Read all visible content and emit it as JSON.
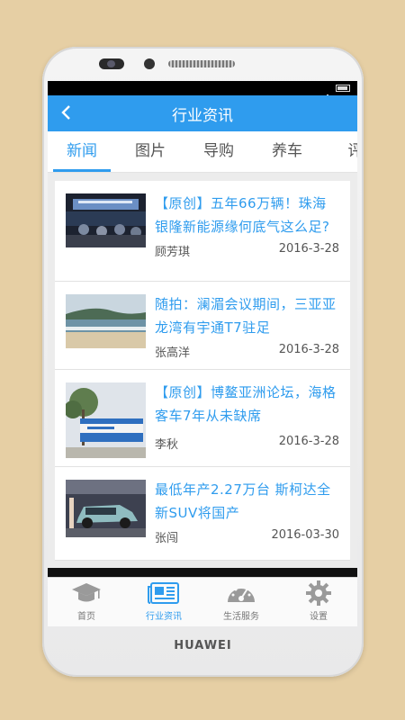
{
  "device": {
    "brand": "HUAWEI"
  },
  "appbar": {
    "title": "行业资讯",
    "back_icon": "chevron-left-icon"
  },
  "tabs": [
    {
      "label": "新闻",
      "active": true
    },
    {
      "label": "图片",
      "active": false
    },
    {
      "label": "导购",
      "active": false
    },
    {
      "label": "养车",
      "active": false
    },
    {
      "label": "评",
      "active": false
    }
  ],
  "articles": [
    {
      "title": "【原创】五年66万辆！珠海银隆新能源缘何底气这么足?",
      "author": "顾芳琪",
      "date": "2016-3-28",
      "thumb": "conference-stage"
    },
    {
      "title": "随拍：澜湄会议期间，三亚亚龙湾有宇通T7驻足",
      "author": "张高洋",
      "date": "2016-3-28",
      "thumb": "beach"
    },
    {
      "title": "【原创】博鳌亚洲论坛，海格客车7年从未缺席",
      "author": "李秋",
      "date": "2016-3-28",
      "thumb": "road-sign"
    },
    {
      "title": "最低年产2.27万台 斯柯达全新SUV将国产",
      "author": "张闯",
      "date": "2016-03-30",
      "thumb": "suv-car"
    }
  ],
  "bottom_nav": [
    {
      "label": "首页",
      "icon": "graduation-cap-icon",
      "active": false
    },
    {
      "label": "行业资讯",
      "icon": "newspaper-icon",
      "active": true
    },
    {
      "label": "生活服务",
      "icon": "speedometer-icon",
      "active": false
    },
    {
      "label": "设置",
      "icon": "gear-icon",
      "active": false
    }
  ],
  "colors": {
    "accent": "#2f9cee",
    "background": "#e6cfa4"
  }
}
